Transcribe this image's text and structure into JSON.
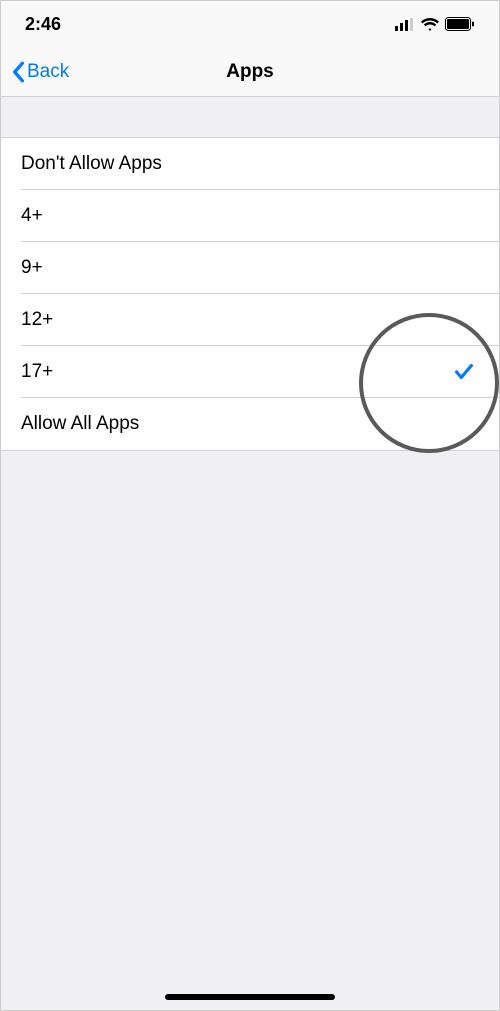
{
  "status": {
    "time": "2:46"
  },
  "nav": {
    "back_label": "Back",
    "title": "Apps"
  },
  "options": {
    "items": [
      {
        "label": "Don't Allow Apps",
        "selected": false
      },
      {
        "label": "4+",
        "selected": false
      },
      {
        "label": "9+",
        "selected": false
      },
      {
        "label": "12+",
        "selected": false
      },
      {
        "label": "17+",
        "selected": true
      },
      {
        "label": "Allow All Apps",
        "selected": false
      }
    ]
  }
}
